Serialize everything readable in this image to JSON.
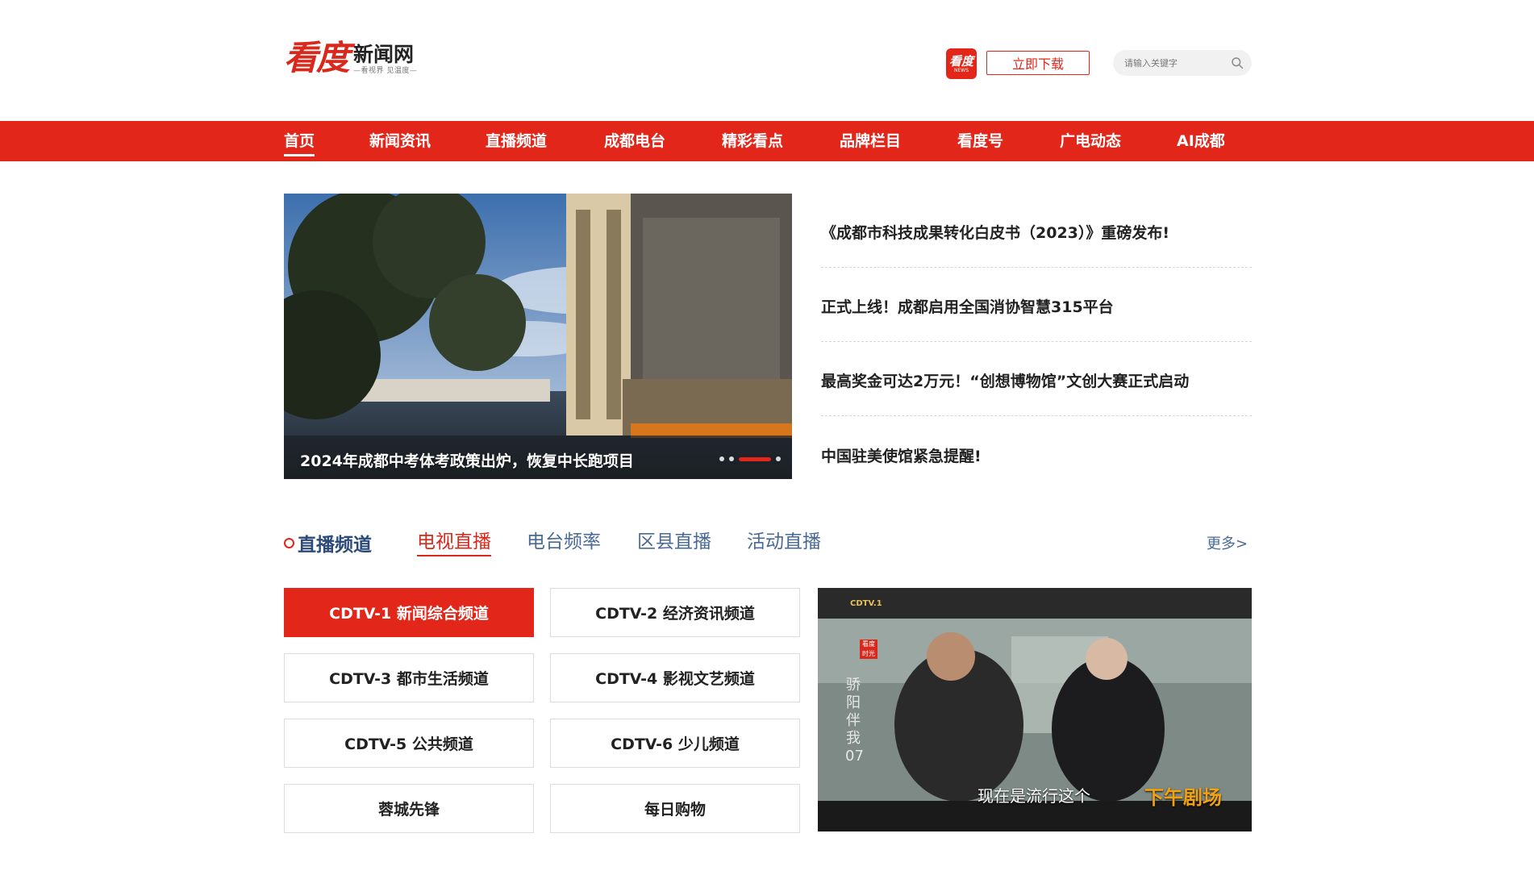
{
  "header": {
    "logo_mark": "看度",
    "logo_name": "新闻网",
    "logo_slogan": "—看视界 见温度—",
    "app_icon_text": "看度",
    "app_icon_sub": "NEWS",
    "download_label": "立即下载",
    "search_placeholder": "请输入关键字"
  },
  "nav": {
    "items": [
      "首页",
      "新闻资讯",
      "直播频道",
      "成都电台",
      "精彩看点",
      "品牌栏目",
      "看度号",
      "广电动态",
      "AI成都"
    ],
    "active_index": 0
  },
  "hero": {
    "caption": "2024年成都中考体考政策出炉，恢复中长跑项目",
    "slide_count": 4,
    "active_slide": 2
  },
  "headlines": [
    "《成都市科技成果转化白皮书（2023）》重磅发布!",
    "正式上线！成都启用全国消协智慧315平台",
    "最高奖金可达2万元！“创想博物馆”文创大赛正式启动",
    "中国驻美使馆紧急提醒!"
  ],
  "live": {
    "section_title": "直播频道",
    "tabs": [
      "电视直播",
      "电台频率",
      "区县直播",
      "活动直播"
    ],
    "active_tab": 0,
    "more_label": "更多>",
    "channels": [
      "CDTV-1 新闻综合频道",
      "CDTV-2 经济资讯频道",
      "CDTV-3 都市生活频道",
      "CDTV-4 影视文艺频道",
      "CDTV-5 公共频道",
      "CDTV-6 少儿频道",
      "蓉城先锋",
      "每日购物"
    ],
    "active_channel": 0,
    "player": {
      "channel_logo": "CDTV.1",
      "badge": "看度 时光",
      "vertical_text": "骄阳伴我07",
      "subtitle": "现在是流行这个",
      "corner_text": "下午剧场"
    }
  },
  "colors": {
    "brand_red": "#e2261a",
    "link_blue": "#4a6a95"
  }
}
